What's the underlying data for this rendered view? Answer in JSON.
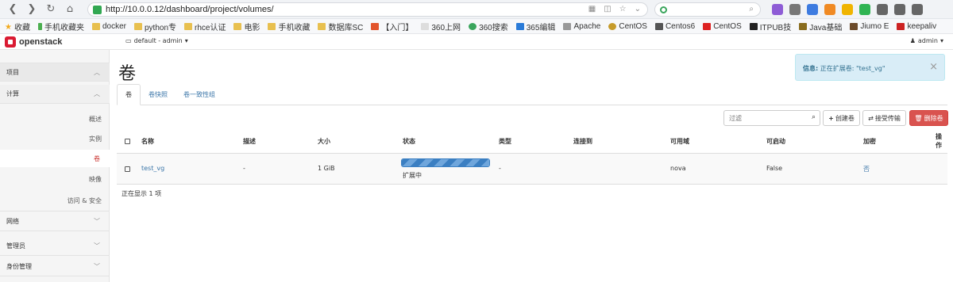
{
  "browser": {
    "url": "http://10.0.0.12/dashboard/project/volumes/",
    "bookmarks": [
      "收藏",
      "手机收藏夹",
      "docker",
      "python专",
      "rhce认证",
      "电影",
      "手机收藏",
      "数据库SC",
      "【入门】",
      "360上网",
      "360搜索",
      "365编辑",
      "Apache",
      "CentOS",
      "Centos6",
      "CentOS",
      "ITPUB技",
      "Java基础",
      "Jiumo E",
      "keepaliv"
    ]
  },
  "header": {
    "logo": "openstack",
    "project": "default - admin",
    "user": "admin"
  },
  "sidebar": {
    "project": "项目",
    "compute": "计算",
    "overview": "概述",
    "instances": "实例",
    "volumes": "卷",
    "images": "映像",
    "access": "访问 & 安全",
    "network": "网络",
    "admin": "管理员",
    "identity": "身份管理"
  },
  "main": {
    "title": "卷",
    "tabs": [
      "卷",
      "卷快照",
      "卷一致性组"
    ],
    "filter_placeholder": "过滤",
    "create_button": "创建卷",
    "accept_button": "接受传输",
    "delete_button": "删除卷",
    "columns": [
      "名称",
      "描述",
      "大小",
      "状态",
      "类型",
      "连接到",
      "可用域",
      "可启动",
      "加密",
      "操作"
    ],
    "rows": [
      {
        "name": "test_vg",
        "description": "-",
        "size": "1 GiB",
        "status": "扩展中",
        "type": "-",
        "attached": "",
        "zone": "nova",
        "bootable": "False",
        "encrypted": "否"
      }
    ],
    "count": "正在显示 1 项"
  },
  "alert": {
    "label": "信息:",
    "message": "正在扩展卷: \"test_vg\""
  }
}
